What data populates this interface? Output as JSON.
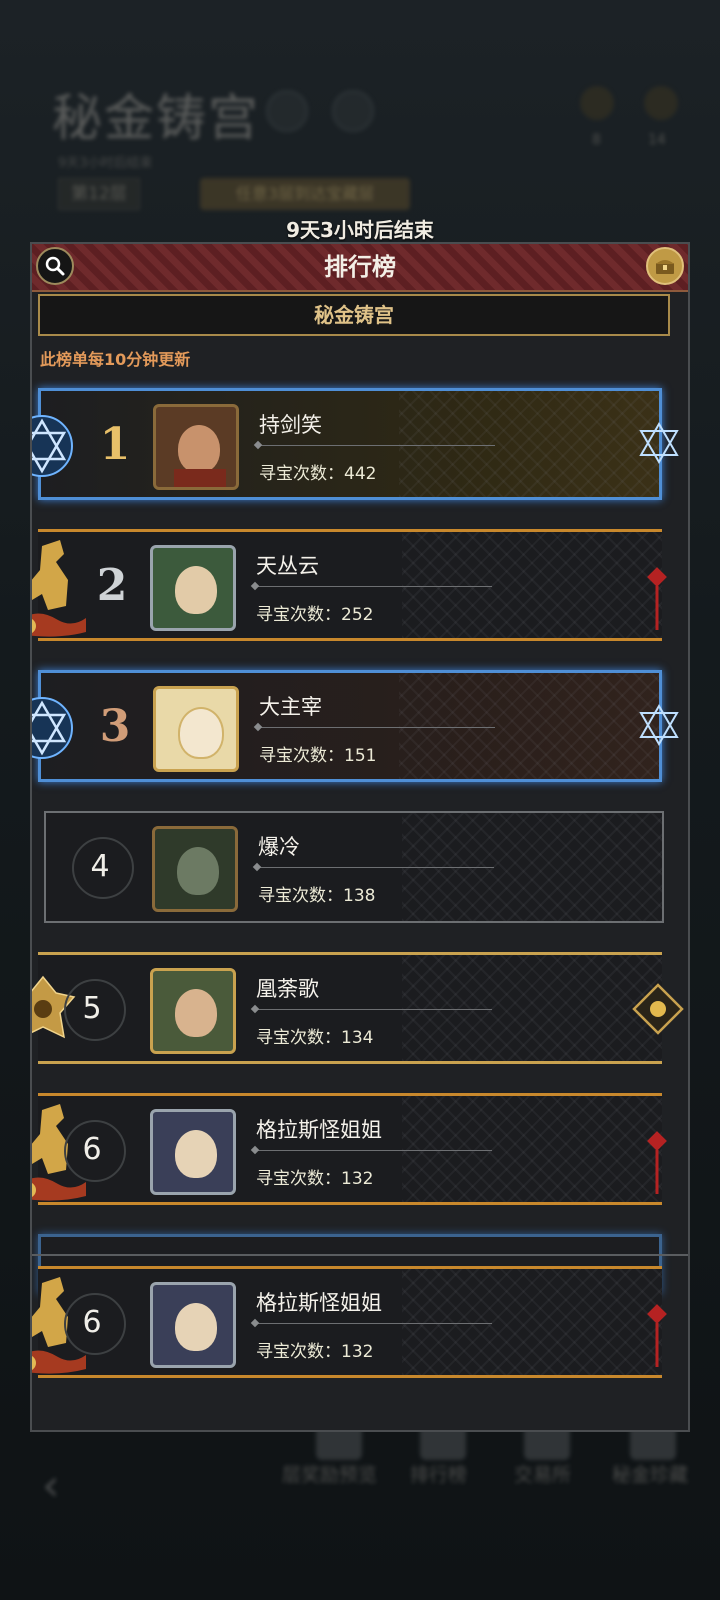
{
  "background": {
    "title": "秘金铸宫",
    "sub": "9天3小时后结束",
    "floor": "第12层",
    "task": "任意3层到达宝藏层",
    "resources": [
      {
        "value": "8"
      },
      {
        "value": "14"
      }
    ],
    "nav": [
      {
        "label": "层奖励预览"
      },
      {
        "label": "排行榜"
      },
      {
        "label": "交易所"
      },
      {
        "label": "秘金珍藏"
      }
    ]
  },
  "timer": "9天3小时后结束",
  "header": {
    "title": "排行榜",
    "search_icon": "search-icon",
    "chest_icon": "treasure-chest-icon"
  },
  "season_title": "秘金铸宫",
  "update_note": "此榜单每10分钟更新",
  "score_label": "寻宝次数：",
  "colors": {
    "accent_gold": "#dfc288",
    "note_orange": "#e39a5a",
    "blue_frame": "#4f8fd6",
    "red_frame": "#c8882c"
  },
  "entries": [
    {
      "rank": "1",
      "name": "持剑笑",
      "score": "442",
      "frame": "blue"
    },
    {
      "rank": "2",
      "name": "天丛云",
      "score": "252",
      "frame": "red"
    },
    {
      "rank": "3",
      "name": "大主宰",
      "score": "151",
      "frame": "blue"
    },
    {
      "rank": "4",
      "name": "爆冷",
      "score": "138",
      "frame": "plain"
    },
    {
      "rank": "5",
      "name": "凰荼歌",
      "score": "134",
      "frame": "gold"
    },
    {
      "rank": "6",
      "name": "格拉斯怪姐姐",
      "score": "132",
      "frame": "red"
    }
  ],
  "self_entry": {
    "rank": "6",
    "name": "格拉斯怪姐姐",
    "score": "132"
  }
}
